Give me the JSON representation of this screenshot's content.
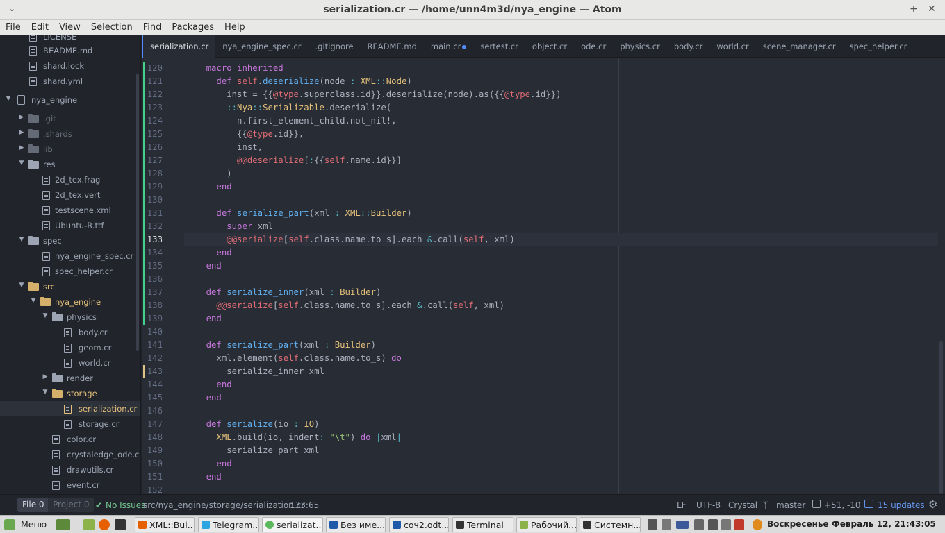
{
  "window": {
    "title": "serialization.cr — /home/unn4m3d/nya_engine — Atom"
  },
  "menu": [
    "File",
    "Edit",
    "View",
    "Selection",
    "Find",
    "Packages",
    "Help"
  ],
  "tree": [
    {
      "label": "LICENSE",
      "type": "file"
    },
    {
      "label": "README.md",
      "type": "readme"
    },
    {
      "label": "shard.lock",
      "type": "file"
    },
    {
      "label": "shard.yml",
      "type": "file"
    },
    {
      "label": "nya_engine",
      "type": "root"
    },
    {
      "label": ".git",
      "type": "dir-closed-ignored"
    },
    {
      "label": ".shards",
      "type": "dir-closed-ignored"
    },
    {
      "label": "lib",
      "type": "dir-closed-ignored"
    },
    {
      "label": "res",
      "type": "dir-open"
    },
    {
      "label": "2d_tex.frag",
      "type": "file"
    },
    {
      "label": "2d_tex.vert",
      "type": "file"
    },
    {
      "label": "testscene.xml",
      "type": "file"
    },
    {
      "label": "Ubuntu-R.ttf",
      "type": "file"
    },
    {
      "label": "spec",
      "type": "dir-open"
    },
    {
      "label": "nya_engine_spec.cr",
      "type": "file"
    },
    {
      "label": "spec_helper.cr",
      "type": "file"
    },
    {
      "label": "src",
      "type": "dir-open-modified"
    },
    {
      "label": "nya_engine",
      "type": "dir-open-modified"
    },
    {
      "label": "physics",
      "type": "dir-open"
    },
    {
      "label": "body.cr",
      "type": "file"
    },
    {
      "label": "geom.cr",
      "type": "file"
    },
    {
      "label": "world.cr",
      "type": "file"
    },
    {
      "label": "render",
      "type": "dir-closed"
    },
    {
      "label": "storage",
      "type": "dir-open-modified"
    },
    {
      "label": "serialization.cr",
      "type": "file-selected"
    },
    {
      "label": "storage.cr",
      "type": "file"
    },
    {
      "label": "color.cr",
      "type": "file"
    },
    {
      "label": "crystaledge_ode.cr",
      "type": "file"
    },
    {
      "label": "drawutils.cr",
      "type": "file"
    },
    {
      "label": "event.cr",
      "type": "file"
    }
  ],
  "tabs": [
    {
      "label": "serialization.cr",
      "active": true
    },
    {
      "label": "nya_engine_spec.cr"
    },
    {
      "label": ".gitignore"
    },
    {
      "label": "README.md"
    },
    {
      "label": "main.cr",
      "modified": true
    },
    {
      "label": "sertest.cr"
    },
    {
      "label": "object.cr"
    },
    {
      "label": "ode.cr"
    },
    {
      "label": "physics.cr"
    },
    {
      "label": "body.cr"
    },
    {
      "label": "world.cr"
    },
    {
      "label": "scene_manager.cr"
    },
    {
      "label": "spec_helper.cr"
    }
  ],
  "editor": {
    "current_line": "133",
    "lines": [
      {
        "n": "120",
        "code": "    macro inherited"
      },
      {
        "n": "121",
        "code": "      def self.deserialize(node : XML::Node)"
      },
      {
        "n": "122",
        "code": "        inst = {{@type.superclass.id}}.deserialize(node).as({{@type.id}})"
      },
      {
        "n": "123",
        "code": "        ::Nya::Serializable.deserialize("
      },
      {
        "n": "124",
        "code": "          n.first_element_child.not_nil!,"
      },
      {
        "n": "125",
        "code": "          {{@type.id}},"
      },
      {
        "n": "126",
        "code": "          inst,"
      },
      {
        "n": "127",
        "code": "          @@deserialize[:{{self.name.id}}]"
      },
      {
        "n": "128",
        "code": "        )"
      },
      {
        "n": "129",
        "code": "      end"
      },
      {
        "n": "130",
        "code": ""
      },
      {
        "n": "131",
        "code": "      def serialize_part(xml : XML::Builder)"
      },
      {
        "n": "132",
        "code": "        super xml"
      },
      {
        "n": "133",
        "code": "        @@serialize[self.class.name.to_s].each &.call(self, xml)"
      },
      {
        "n": "134",
        "code": "      end"
      },
      {
        "n": "135",
        "code": "    end"
      },
      {
        "n": "136",
        "code": ""
      },
      {
        "n": "137",
        "code": "    def serialize_inner(xml : Builder)"
      },
      {
        "n": "138",
        "code": "      @@serialize[self.class.name.to_s].each &.call(self, xml)"
      },
      {
        "n": "139",
        "code": "    end"
      },
      {
        "n": "140",
        "code": ""
      },
      {
        "n": "141",
        "code": "    def serialize_part(xml : Builder)"
      },
      {
        "n": "142",
        "code": "      xml.element(self.class.name.to_s) do"
      },
      {
        "n": "143",
        "code": "        serialize_inner xml"
      },
      {
        "n": "144",
        "code": "      end"
      },
      {
        "n": "145",
        "code": "    end"
      },
      {
        "n": "146",
        "code": ""
      },
      {
        "n": "147",
        "code": "    def serialize(io : IO)"
      },
      {
        "n": "148",
        "code": "      XML.build(io, indent: \"\\t\") do |xml|"
      },
      {
        "n": "149",
        "code": "        serialize_part xml"
      },
      {
        "n": "150",
        "code": "      end"
      },
      {
        "n": "151",
        "code": "    end"
      },
      {
        "n": "152",
        "code": ""
      }
    ]
  },
  "status": {
    "file_tab": "File 0",
    "project_tab": "Project 0",
    "issues": "No Issues",
    "path": "src/nya_engine/storage/serialization.cr",
    "cursor": "133:65",
    "line_ending": "LF",
    "encoding": "UTF-8",
    "grammar": "Crystal",
    "branch": "master",
    "diff": "+51, -10",
    "updates": "15 updates"
  },
  "taskbar": {
    "menu_label": "Меню",
    "tasks": [
      {
        "label": "XML::Bui...",
        "color": "#e66000"
      },
      {
        "label": "Telegram...",
        "color": "#2ca5e0"
      },
      {
        "label": "serializat...",
        "color": "#5cb85c"
      },
      {
        "label": "Без име...",
        "color": "#1e5aa8"
      },
      {
        "label": "соч2.odt...",
        "color": "#1e5aa8"
      },
      {
        "label": "Terminal",
        "color": "#333333"
      },
      {
        "label": "Рабочий...",
        "color": "#8bb34a"
      },
      {
        "label": "Системн...",
        "color": "#333333"
      }
    ],
    "clock": "Воскресенье Февраль 12, 21:43:05"
  }
}
